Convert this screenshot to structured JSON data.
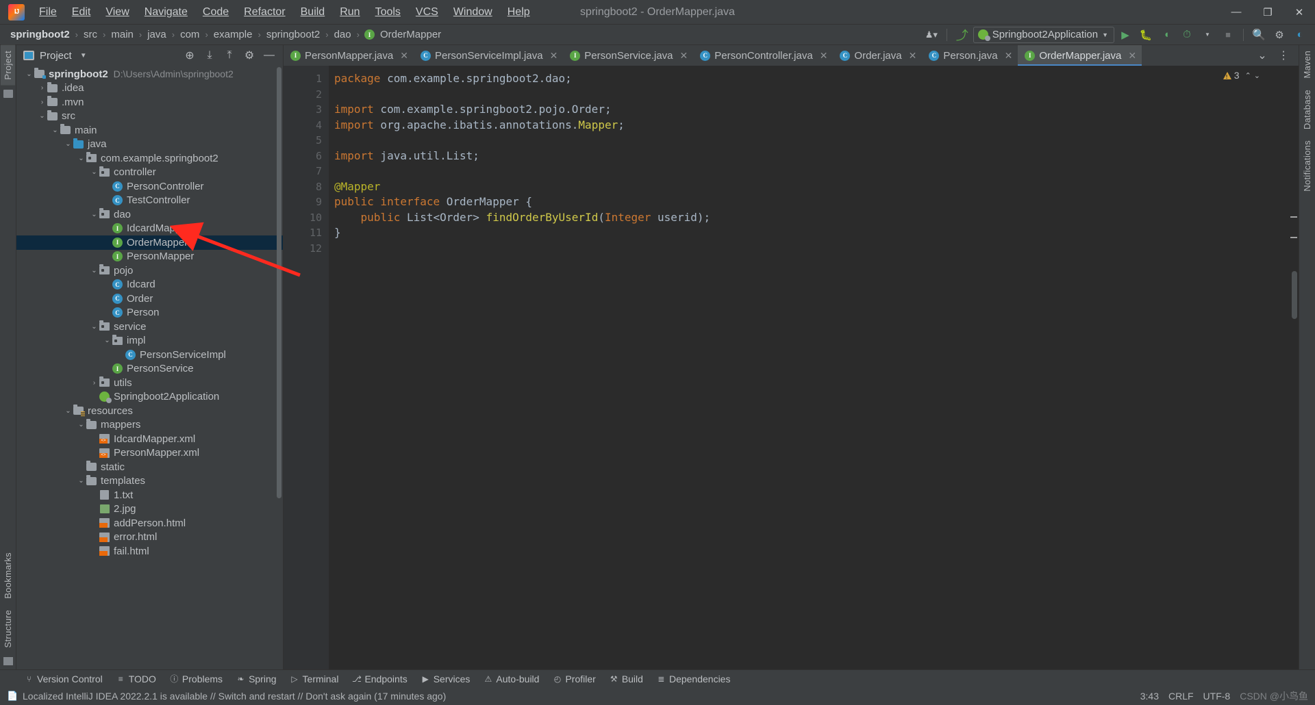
{
  "window": {
    "title": "springboot2 - OrderMapper.java",
    "logo_text": "IJ",
    "minimize": "—",
    "maximize": "❐",
    "close": "✕"
  },
  "menu": [
    {
      "label": "File"
    },
    {
      "label": "Edit"
    },
    {
      "label": "View"
    },
    {
      "label": "Navigate"
    },
    {
      "label": "Code"
    },
    {
      "label": "Refactor"
    },
    {
      "label": "Build"
    },
    {
      "label": "Run"
    },
    {
      "label": "Tools"
    },
    {
      "label": "VCS"
    },
    {
      "label": "Window"
    },
    {
      "label": "Help"
    }
  ],
  "breadcrumb": {
    "sep": "›",
    "items": [
      "springboot2",
      "src",
      "main",
      "java",
      "com",
      "example",
      "springboot2",
      "dao",
      "OrderMapper"
    ],
    "last_icon": "interface-icon"
  },
  "nav_toolbar": {
    "run_config": "Springboot2Application",
    "run_config_caret": "▼",
    "buttons": [
      {
        "name": "user-icon",
        "glyph": "☰"
      },
      {
        "name": "updates-icon",
        "glyph": "↖"
      },
      {
        "name": "run-button",
        "glyph": "▶"
      },
      {
        "name": "debug-button",
        "glyph": "☸"
      },
      {
        "name": "run-coverage-button",
        "glyph": "◐"
      },
      {
        "name": "profiler-button",
        "glyph": "◴"
      },
      {
        "name": "stop-button",
        "glyph": "■"
      },
      {
        "name": "search-everywhere-icon",
        "glyph": "⌕"
      },
      {
        "name": "settings-gear-icon",
        "glyph": "⚙"
      },
      {
        "name": "ide-assistant-icon",
        "glyph": "◗"
      }
    ]
  },
  "left_strip": {
    "tabs": [
      {
        "label": "Project",
        "active": true
      },
      {
        "label": "Bookmarks",
        "active": false
      },
      {
        "label": "Structure",
        "active": false
      }
    ]
  },
  "right_strip": {
    "tabs": [
      {
        "label": "Maven"
      },
      {
        "label": "Database"
      },
      {
        "label": "Notifications"
      }
    ]
  },
  "project_panel": {
    "title": "Project",
    "caret": "▼",
    "toolbar_icons": [
      {
        "name": "select-opened-file-icon",
        "glyph": "⊕"
      },
      {
        "name": "expand-all-icon",
        "glyph": "⤓"
      },
      {
        "name": "collapse-all-icon",
        "glyph": "⤒"
      },
      {
        "name": "settings-gear-icon",
        "glyph": "⚙"
      },
      {
        "name": "hide-panel-icon",
        "glyph": "—"
      }
    ],
    "tree": [
      {
        "indent": 0,
        "arrow": "⌄",
        "icon": "module-folder",
        "label": "springboot2",
        "bold": true,
        "sub": "D:\\Users\\Admin\\springboot2"
      },
      {
        "indent": 1,
        "arrow": "›",
        "icon": "folder",
        "label": ".idea"
      },
      {
        "indent": 1,
        "arrow": "›",
        "icon": "folder",
        "label": ".mvn"
      },
      {
        "indent": 1,
        "arrow": "⌄",
        "icon": "folder",
        "label": "src"
      },
      {
        "indent": 2,
        "arrow": "⌄",
        "icon": "folder",
        "label": "main"
      },
      {
        "indent": 3,
        "arrow": "⌄",
        "icon": "source-folder",
        "label": "java"
      },
      {
        "indent": 4,
        "arrow": "⌄",
        "icon": "package",
        "label": "com.example.springboot2"
      },
      {
        "indent": 5,
        "arrow": "⌄",
        "icon": "package",
        "label": "controller"
      },
      {
        "indent": 6,
        "arrow": "",
        "icon": "class",
        "label": "PersonController"
      },
      {
        "indent": 6,
        "arrow": "",
        "icon": "class",
        "label": "TestController"
      },
      {
        "indent": 5,
        "arrow": "⌄",
        "icon": "package",
        "label": "dao"
      },
      {
        "indent": 6,
        "arrow": "",
        "icon": "interface",
        "label": "IdcardMapper"
      },
      {
        "indent": 6,
        "arrow": "",
        "icon": "interface",
        "label": "OrderMapper",
        "selected": true
      },
      {
        "indent": 6,
        "arrow": "",
        "icon": "interface",
        "label": "PersonMapper"
      },
      {
        "indent": 5,
        "arrow": "⌄",
        "icon": "package",
        "label": "pojo"
      },
      {
        "indent": 6,
        "arrow": "",
        "icon": "class",
        "label": "Idcard"
      },
      {
        "indent": 6,
        "arrow": "",
        "icon": "class",
        "label": "Order"
      },
      {
        "indent": 6,
        "arrow": "",
        "icon": "class",
        "label": "Person"
      },
      {
        "indent": 5,
        "arrow": "⌄",
        "icon": "package",
        "label": "service"
      },
      {
        "indent": 6,
        "arrow": "⌄",
        "icon": "package",
        "label": "impl"
      },
      {
        "indent": 7,
        "arrow": "",
        "icon": "class",
        "label": "PersonServiceImpl"
      },
      {
        "indent": 6,
        "arrow": "",
        "icon": "interface",
        "label": "PersonService"
      },
      {
        "indent": 5,
        "arrow": "›",
        "icon": "package",
        "label": "utils"
      },
      {
        "indent": 5,
        "arrow": "",
        "icon": "spring-class",
        "label": "Springboot2Application"
      },
      {
        "indent": 3,
        "arrow": "⌄",
        "icon": "resource-folder",
        "label": "resources"
      },
      {
        "indent": 4,
        "arrow": "⌄",
        "icon": "folder",
        "label": "mappers"
      },
      {
        "indent": 5,
        "arrow": "",
        "icon": "xml-file",
        "label": "IdcardMapper.xml"
      },
      {
        "indent": 5,
        "arrow": "",
        "icon": "xml-file",
        "label": "PersonMapper.xml"
      },
      {
        "indent": 4,
        "arrow": "",
        "icon": "folder",
        "label": "static"
      },
      {
        "indent": 4,
        "arrow": "⌄",
        "icon": "folder",
        "label": "templates"
      },
      {
        "indent": 5,
        "arrow": "",
        "icon": "text-file",
        "label": "1.txt"
      },
      {
        "indent": 5,
        "arrow": "",
        "icon": "image-file",
        "label": "2.jpg"
      },
      {
        "indent": 5,
        "arrow": "",
        "icon": "html-file",
        "label": "addPerson.html"
      },
      {
        "indent": 5,
        "arrow": "",
        "icon": "html-file",
        "label": "error.html"
      },
      {
        "indent": 5,
        "arrow": "",
        "icon": "html-file",
        "label": "fail.html"
      }
    ]
  },
  "editor": {
    "tabs": [
      {
        "label": "PersonMapper.java",
        "icon": "interface",
        "active": false
      },
      {
        "label": "PersonServiceImpl.java",
        "icon": "class",
        "active": false
      },
      {
        "label": "PersonService.java",
        "icon": "interface",
        "active": false
      },
      {
        "label": "PersonController.java",
        "icon": "class",
        "active": false
      },
      {
        "label": "Order.java",
        "icon": "class",
        "active": false
      },
      {
        "label": "Person.java",
        "icon": "class",
        "active": false
      },
      {
        "label": "OrderMapper.java",
        "icon": "interface",
        "active": true
      }
    ],
    "tab_close_glyph": "✕",
    "tabs_right_icons": [
      {
        "name": "tab-list-chevron-icon",
        "glyph": "⌄"
      },
      {
        "name": "tab-options-icon",
        "glyph": "⋮"
      }
    ],
    "warning_count": "3",
    "warning_nav": [
      "⌃",
      "⌄"
    ],
    "lines": [
      {
        "n": "1",
        "fold": "",
        "segs": [
          {
            "t": "package",
            "c": "kw"
          },
          {
            "t": " com.example.springboot2.dao;",
            "c": "txt"
          }
        ]
      },
      {
        "n": "2",
        "fold": "",
        "segs": []
      },
      {
        "n": "3",
        "fold": "⊖",
        "segs": [
          {
            "t": "import",
            "c": "kw"
          },
          {
            "t": " com.example.springboot2.pojo.Order;",
            "c": "txt"
          }
        ]
      },
      {
        "n": "4",
        "fold": "",
        "segs": [
          {
            "t": "import",
            "c": "kw"
          },
          {
            "t": " org.apache.ibatis.annotations.",
            "c": "txt"
          },
          {
            "t": "Mapper",
            "c": "yel"
          },
          {
            "t": ";",
            "c": "txt"
          }
        ]
      },
      {
        "n": "5",
        "fold": "",
        "segs": []
      },
      {
        "n": "6",
        "fold": "⊖",
        "segs": [
          {
            "t": "import",
            "c": "kw"
          },
          {
            "t": " java.util.List;",
            "c": "txt"
          }
        ]
      },
      {
        "n": "7",
        "fold": "",
        "segs": []
      },
      {
        "n": "8",
        "fold": "",
        "segs": [
          {
            "t": "@Mapper",
            "c": "ann"
          }
        ]
      },
      {
        "n": "9",
        "fold": "",
        "bean": true,
        "segs": [
          {
            "t": "public interface",
            "c": "kw"
          },
          {
            "t": " OrderMapper {",
            "c": "txt"
          }
        ]
      },
      {
        "n": "10",
        "fold": "",
        "segs": [
          {
            "t": "    public",
            "c": "kw"
          },
          {
            "t": " List<Order> ",
            "c": "txt"
          },
          {
            "t": "findOrderByUserId",
            "c": "yel"
          },
          {
            "t": "(",
            "c": "txt"
          },
          {
            "t": "Integer",
            "c": "kw"
          },
          {
            "t": " userid);",
            "c": "txt"
          }
        ]
      },
      {
        "n": "11",
        "fold": "",
        "segs": [
          {
            "t": "}",
            "c": "txt"
          }
        ]
      },
      {
        "n": "12",
        "fold": "",
        "segs": []
      }
    ]
  },
  "bottom_bar": {
    "items": [
      {
        "label": "Version Control",
        "icon": "branch-icon",
        "glyph": "⑂"
      },
      {
        "label": "TODO",
        "icon": "todo-icon",
        "glyph": "≡"
      },
      {
        "label": "Problems",
        "icon": "problems-icon",
        "glyph": "ⓘ"
      },
      {
        "label": "Spring",
        "icon": "spring-leaf-icon",
        "glyph": "❧"
      },
      {
        "label": "Terminal",
        "icon": "terminal-icon",
        "glyph": "▷"
      },
      {
        "label": "Endpoints",
        "icon": "endpoints-icon",
        "glyph": "⎇"
      },
      {
        "label": "Services",
        "icon": "services-icon",
        "glyph": "▶"
      },
      {
        "label": "Auto-build",
        "icon": "warning-triangle-icon",
        "glyph": "⚠"
      },
      {
        "label": "Profiler",
        "icon": "profiler-icon",
        "glyph": "◴"
      },
      {
        "label": "Build",
        "icon": "hammer-icon",
        "glyph": "⚒"
      },
      {
        "label": "Dependencies",
        "icon": "dependencies-icon",
        "glyph": "≣"
      }
    ]
  },
  "status_bar": {
    "icon": "notification-icon",
    "message": "Localized IntelliJ IDEA 2022.2.1 is available // Switch and restart // Don't ask again (17 minutes ago)",
    "caret_position": "3:43",
    "line_separator": "CRLF",
    "encoding": "UTF-8",
    "watermark": "CSDN @小鸟鱼"
  },
  "colors": {
    "ui_bg": "#3c3f41",
    "editor_bg": "#2b2b2b",
    "gutter_bg": "#313335",
    "selection": "#0d293e",
    "accent": "#4a88c7",
    "keyword": "#cc7832",
    "annotation": "#bbb529",
    "method": "#d0c94a",
    "text": "#a9b7c6",
    "arrow_annotation": "#ff2a1f"
  }
}
